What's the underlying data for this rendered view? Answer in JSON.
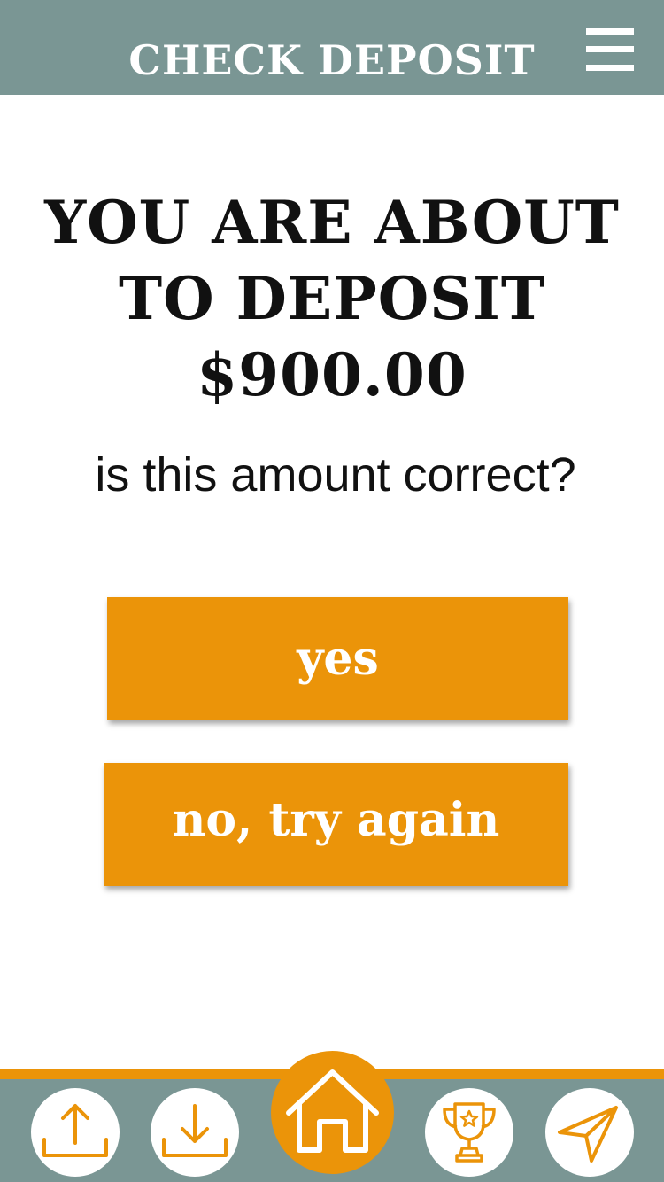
{
  "header": {
    "title": "CHECK DEPOSIT",
    "menu_icon": "hamburger-menu-icon"
  },
  "confirm": {
    "heading_line1": "YOU ARE ABOUT",
    "heading_line2": "TO DEPOSIT",
    "amount": "$900.00",
    "question": "is this amount correct?"
  },
  "buttons": {
    "yes_label": "yes",
    "retry_label": "no, try again"
  },
  "bottom_nav": {
    "items": [
      {
        "icon": "upload-icon"
      },
      {
        "icon": "download-icon"
      },
      {
        "icon": "home-icon"
      },
      {
        "icon": "trophy-icon"
      },
      {
        "icon": "send-icon"
      }
    ]
  },
  "colors": {
    "header_bg": "#7a9694",
    "accent": "#eb9409",
    "text": "#111111",
    "background": "#ffffff"
  }
}
